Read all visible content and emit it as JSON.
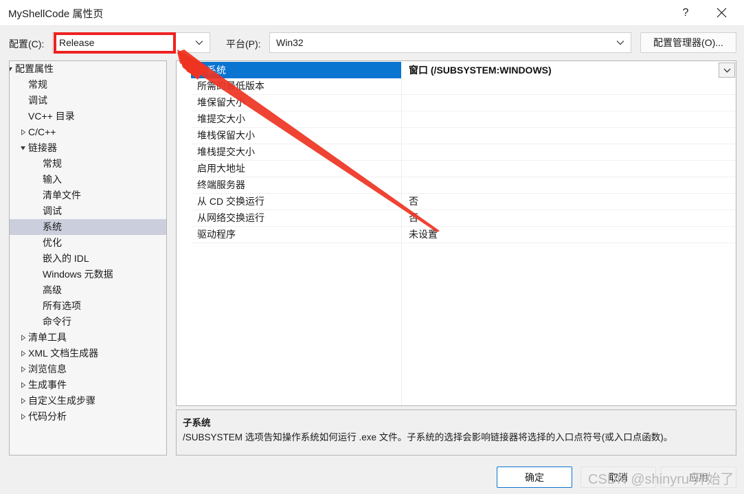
{
  "window": {
    "title": "MyShellCode 属性页",
    "help_icon": "?",
    "close_icon": "close-icon"
  },
  "toolbar": {
    "config_label": "配置(C):",
    "config_value": "Release",
    "platform_label": "平台(P):",
    "platform_value": "Win32",
    "config_manager_label": "配置管理器(O)..."
  },
  "tree": {
    "items": [
      {
        "label": "配置属性",
        "depth": 0,
        "arrow": "expanded",
        "selected": false
      },
      {
        "label": "常规",
        "depth": 1,
        "arrow": "none",
        "selected": false
      },
      {
        "label": "调试",
        "depth": 1,
        "arrow": "none",
        "selected": false
      },
      {
        "label": "VC++ 目录",
        "depth": 1,
        "arrow": "none",
        "selected": false
      },
      {
        "label": "C/C++",
        "depth": 1,
        "arrow": "collapsed",
        "selected": false
      },
      {
        "label": "链接器",
        "depth": 1,
        "arrow": "expanded",
        "selected": false
      },
      {
        "label": "常规",
        "depth": 2,
        "arrow": "none",
        "selected": false
      },
      {
        "label": "输入",
        "depth": 2,
        "arrow": "none",
        "selected": false
      },
      {
        "label": "清单文件",
        "depth": 2,
        "arrow": "none",
        "selected": false
      },
      {
        "label": "调试",
        "depth": 2,
        "arrow": "none",
        "selected": false
      },
      {
        "label": "系统",
        "depth": 2,
        "arrow": "none",
        "selected": true
      },
      {
        "label": "优化",
        "depth": 2,
        "arrow": "none",
        "selected": false
      },
      {
        "label": "嵌入的 IDL",
        "depth": 2,
        "arrow": "none",
        "selected": false
      },
      {
        "label": "Windows 元数据",
        "depth": 2,
        "arrow": "none",
        "selected": false
      },
      {
        "label": "高级",
        "depth": 2,
        "arrow": "none",
        "selected": false
      },
      {
        "label": "所有选项",
        "depth": 2,
        "arrow": "none",
        "selected": false
      },
      {
        "label": "命令行",
        "depth": 2,
        "arrow": "none",
        "selected": false
      },
      {
        "label": "清单工具",
        "depth": 1,
        "arrow": "collapsed",
        "selected": false
      },
      {
        "label": "XML 文档生成器",
        "depth": 1,
        "arrow": "collapsed",
        "selected": false
      },
      {
        "label": "浏览信息",
        "depth": 1,
        "arrow": "collapsed",
        "selected": false
      },
      {
        "label": "生成事件",
        "depth": 1,
        "arrow": "collapsed",
        "selected": false
      },
      {
        "label": "自定义生成步骤",
        "depth": 1,
        "arrow": "collapsed",
        "selected": false
      },
      {
        "label": "代码分析",
        "depth": 1,
        "arrow": "collapsed",
        "selected": false
      }
    ]
  },
  "grid": {
    "rows": [
      {
        "name": "子系统",
        "value": "窗口 (/SUBSYSTEM:WINDOWS)",
        "selected": true
      },
      {
        "name": "所需的最低版本",
        "value": "",
        "selected": false
      },
      {
        "name": "堆保留大小",
        "value": "",
        "selected": false
      },
      {
        "name": "堆提交大小",
        "value": "",
        "selected": false
      },
      {
        "name": "堆栈保留大小",
        "value": "",
        "selected": false
      },
      {
        "name": "堆栈提交大小",
        "value": "",
        "selected": false
      },
      {
        "name": "启用大地址",
        "value": "",
        "selected": false
      },
      {
        "name": "终端服务器",
        "value": "",
        "selected": false
      },
      {
        "name": "从 CD 交换运行",
        "value": "否",
        "selected": false
      },
      {
        "name": "从网络交换运行",
        "value": "否",
        "selected": false
      },
      {
        "name": "驱动程序",
        "value": "未设置",
        "selected": false
      }
    ],
    "dropdown_icon": "chevron-down-icon"
  },
  "description": {
    "title": "子系统",
    "body": "/SUBSYSTEM 选项告知操作系统如何运行 .exe 文件。子系统的选择会影响链接器将选择的入口点符号(或入口点函数)。"
  },
  "footer": {
    "ok_label": "确定",
    "cancel_label": "取消",
    "apply_label": "应用"
  },
  "watermark": {
    "text": "CSDN @shinyru 开始了"
  },
  "colors": {
    "accent": "#0a74d1",
    "annotation": "#ee2222",
    "tree_selection": "#cbcfdd",
    "dialog_bg": "#f0f0f0"
  }
}
